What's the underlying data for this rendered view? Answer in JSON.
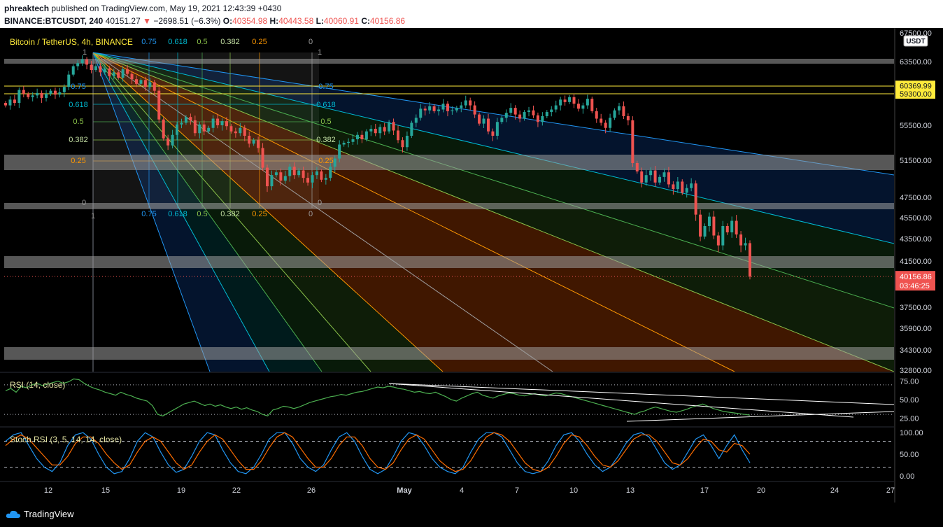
{
  "header": {
    "author": "phreaktech",
    "published_text": "published on TradingView.com, May 19, 2021 12:43:39 +0430",
    "symbol": "BINANCE:BTCUSDT, 240",
    "last": "40151.27",
    "change_arrow": "▼",
    "change": "−2698.51 (−6.3%)",
    "o_label": "O:",
    "o_value": "40354.98",
    "h_label": "H:",
    "h_value": "40443.58",
    "l_label": "L:",
    "l_value": "40060.91",
    "c_label": "C:",
    "c_value": "40156.86"
  },
  "footer": {
    "brand": "TradingView"
  },
  "colors": {
    "up": "#26a69a",
    "down": "#ef5350",
    "bg": "#000000",
    "yellow": "#ffeb3b",
    "fan": [
      "#2196f3",
      "#00bcd4",
      "#4caf50",
      "#8bc34a",
      "#ff9800",
      "#9e9e9e"
    ]
  },
  "chart_data": [
    {
      "type": "candlestick",
      "title": "Bitcoin / TetherUS, 4h, BINANCE",
      "currency": "USDT",
      "x_ticks": [
        "12",
        "15",
        "19",
        "22",
        "26",
        "May",
        "4",
        "7",
        "10",
        "13",
        "17",
        "20",
        "24",
        "27"
      ],
      "y_ticks": [
        67500,
        63500,
        59300,
        55500,
        51500,
        47500,
        45500,
        43500,
        41500,
        37500,
        35900,
        34300,
        32800
      ],
      "ylim": [
        32800,
        67500
      ],
      "price_labels": [
        {
          "value": 60369.99,
          "text": "60369.99"
        },
        {
          "value": 59300,
          "text": "59300.00"
        }
      ],
      "last_price": {
        "value": 40156.86,
        "text": "40156.86",
        "countdown": "03:46:25"
      },
      "gann_fan_left_labels": [
        "0.75",
        "0.618",
        "0.5",
        "0.382",
        "0.25"
      ],
      "gann_fan_top_labels": [
        "0.75",
        "0.618",
        "0.5",
        "0.382",
        "0.25",
        "0"
      ],
      "gann_fan_bottom_labels": [
        "0.75",
        "0.618",
        "0.5",
        "0.382",
        "0.25",
        "0"
      ],
      "gann_markers": [
        "1",
        "1",
        "0",
        "0",
        "1"
      ],
      "closes": [
        57900,
        58600,
        58200,
        59800,
        59300,
        58900,
        59100,
        59400,
        58800,
        59300,
        59700,
        59200,
        59500,
        60200,
        61800,
        62900,
        63300,
        63800,
        63100,
        62400,
        62900,
        62100,
        62600,
        61600,
        62100,
        61400,
        62500,
        61900,
        61200,
        60600,
        61100,
        60200,
        60800,
        59700,
        56200,
        54000,
        53200,
        54400,
        55600,
        55800,
        56500,
        56100,
        54600,
        55600,
        54800,
        55200,
        56300,
        55500,
        56000,
        55400,
        54800,
        54600,
        55200,
        54300,
        53400,
        53800,
        52900,
        50700,
        48700,
        49900,
        50200,
        49300,
        49800,
        50800,
        49900,
        50400,
        49600,
        49100,
        49900,
        50300,
        49400,
        49600,
        50800,
        51700,
        53300,
        53500,
        53600,
        53900,
        54400,
        53900,
        54800,
        55100,
        54600,
        55300,
        54800,
        55900,
        54900,
        53800,
        53000,
        54300,
        55800,
        56400,
        57500,
        57300,
        57800,
        57200,
        57400,
        58100,
        57200,
        57300,
        57600,
        57900,
        58500,
        57900,
        56800,
        55700,
        56300,
        54800,
        54300,
        55900,
        56400,
        57000,
        57600,
        56800,
        56300,
        57100,
        57300,
        56700,
        55900,
        56600,
        57100,
        57400,
        57900,
        58600,
        58300,
        58900,
        58100,
        57500,
        57900,
        58700,
        57200,
        56300,
        55800,
        55200,
        56400,
        57300,
        57800,
        56600,
        56100,
        51200,
        50300,
        49100,
        49900,
        50400,
        49100,
        49700,
        50200,
        48900,
        48400,
        49200,
        48000,
        48500,
        49000,
        45800,
        43700,
        44700,
        45600,
        43800,
        42900,
        44700,
        44100,
        45200,
        43900,
        42900,
        43100,
        40156
      ],
      "rsi": {
        "title": "RSI (14, close)",
        "y_ticks": [
          75,
          50,
          25
        ],
        "ylim": [
          15,
          85
        ],
        "values": [
          62,
          65,
          60,
          68,
          66,
          70,
          72,
          69,
          71,
          73,
          75,
          72,
          74,
          78,
          77,
          72,
          68,
          65,
          63,
          60,
          58,
          56,
          60,
          57,
          55,
          52,
          50,
          48,
          42,
          30,
          28,
          32,
          36,
          40,
          44,
          46,
          48,
          45,
          42,
          44,
          41,
          43,
          40,
          38,
          40,
          37,
          39,
          36,
          34,
          30,
          28,
          36,
          38,
          41,
          40,
          38,
          40,
          43,
          46,
          48,
          50,
          52,
          54,
          55,
          57,
          56,
          58,
          60,
          61,
          63,
          65,
          67,
          66,
          68,
          67,
          65,
          64,
          62,
          60,
          61,
          59,
          58,
          60,
          57,
          54,
          50,
          48,
          52,
          55,
          58,
          60,
          56,
          54,
          52,
          55,
          57,
          59,
          58,
          56,
          55,
          57,
          58,
          56,
          55,
          57,
          59,
          58,
          56,
          54,
          52,
          50,
          48,
          46,
          44,
          42,
          40,
          38,
          36,
          34,
          32,
          30,
          33,
          35,
          38,
          40,
          38,
          36,
          34,
          33,
          35,
          37,
          40,
          42,
          44,
          41,
          38,
          36,
          34,
          33,
          32,
          31,
          30,
          29
        ]
      },
      "stoch_rsi": {
        "title": "Stoch RSI (3, 5, 14, 14, close)",
        "y_ticks": [
          100,
          50,
          0
        ],
        "ylim": [
          -10,
          110
        ],
        "k": [
          80,
          95,
          100,
          70,
          40,
          20,
          10,
          30,
          70,
          95,
          100,
          85,
          50,
          20,
          5,
          10,
          40,
          80,
          100,
          90,
          55,
          25,
          8,
          15,
          45,
          80,
          100,
          95,
          60,
          30,
          10,
          5,
          20,
          50,
          85,
          100,
          100,
          75,
          40,
          20,
          10,
          25,
          60,
          90,
          100,
          80,
          45,
          15,
          5,
          15,
          45,
          80,
          100,
          95,
          70,
          40,
          20,
          10,
          5,
          20,
          55,
          85,
          100,
          100,
          90,
          60,
          30,
          10,
          5,
          10,
          35,
          70,
          95,
          100,
          80,
          50,
          25,
          10,
          20,
          45,
          75,
          95,
          100,
          90,
          60,
          30,
          15,
          25,
          55,
          85,
          95,
          70,
          40,
          70,
          95,
          60,
          30
        ],
        "d": [
          70,
          85,
          95,
          85,
          65,
          45,
          25,
          25,
          45,
          75,
          90,
          90,
          75,
          50,
          30,
          15,
          25,
          55,
          80,
          90,
          80,
          55,
          30,
          15,
          25,
          55,
          80,
          95,
          85,
          60,
          35,
          15,
          15,
          35,
          65,
          90,
          100,
          90,
          65,
          40,
          20,
          20,
          40,
          70,
          90,
          90,
          70,
          40,
          20,
          15,
          30,
          60,
          85,
          95,
          85,
          60,
          35,
          20,
          10,
          15,
          35,
          65,
          90,
          100,
          95,
          80,
          55,
          30,
          15,
          10,
          20,
          45,
          75,
          95,
          90,
          70,
          45,
          25,
          20,
          35,
          60,
          85,
          95,
          95,
          80,
          55,
          30,
          25,
          40,
          65,
          85,
          80,
          60,
          55,
          75,
          70,
          50
        ]
      }
    }
  ]
}
